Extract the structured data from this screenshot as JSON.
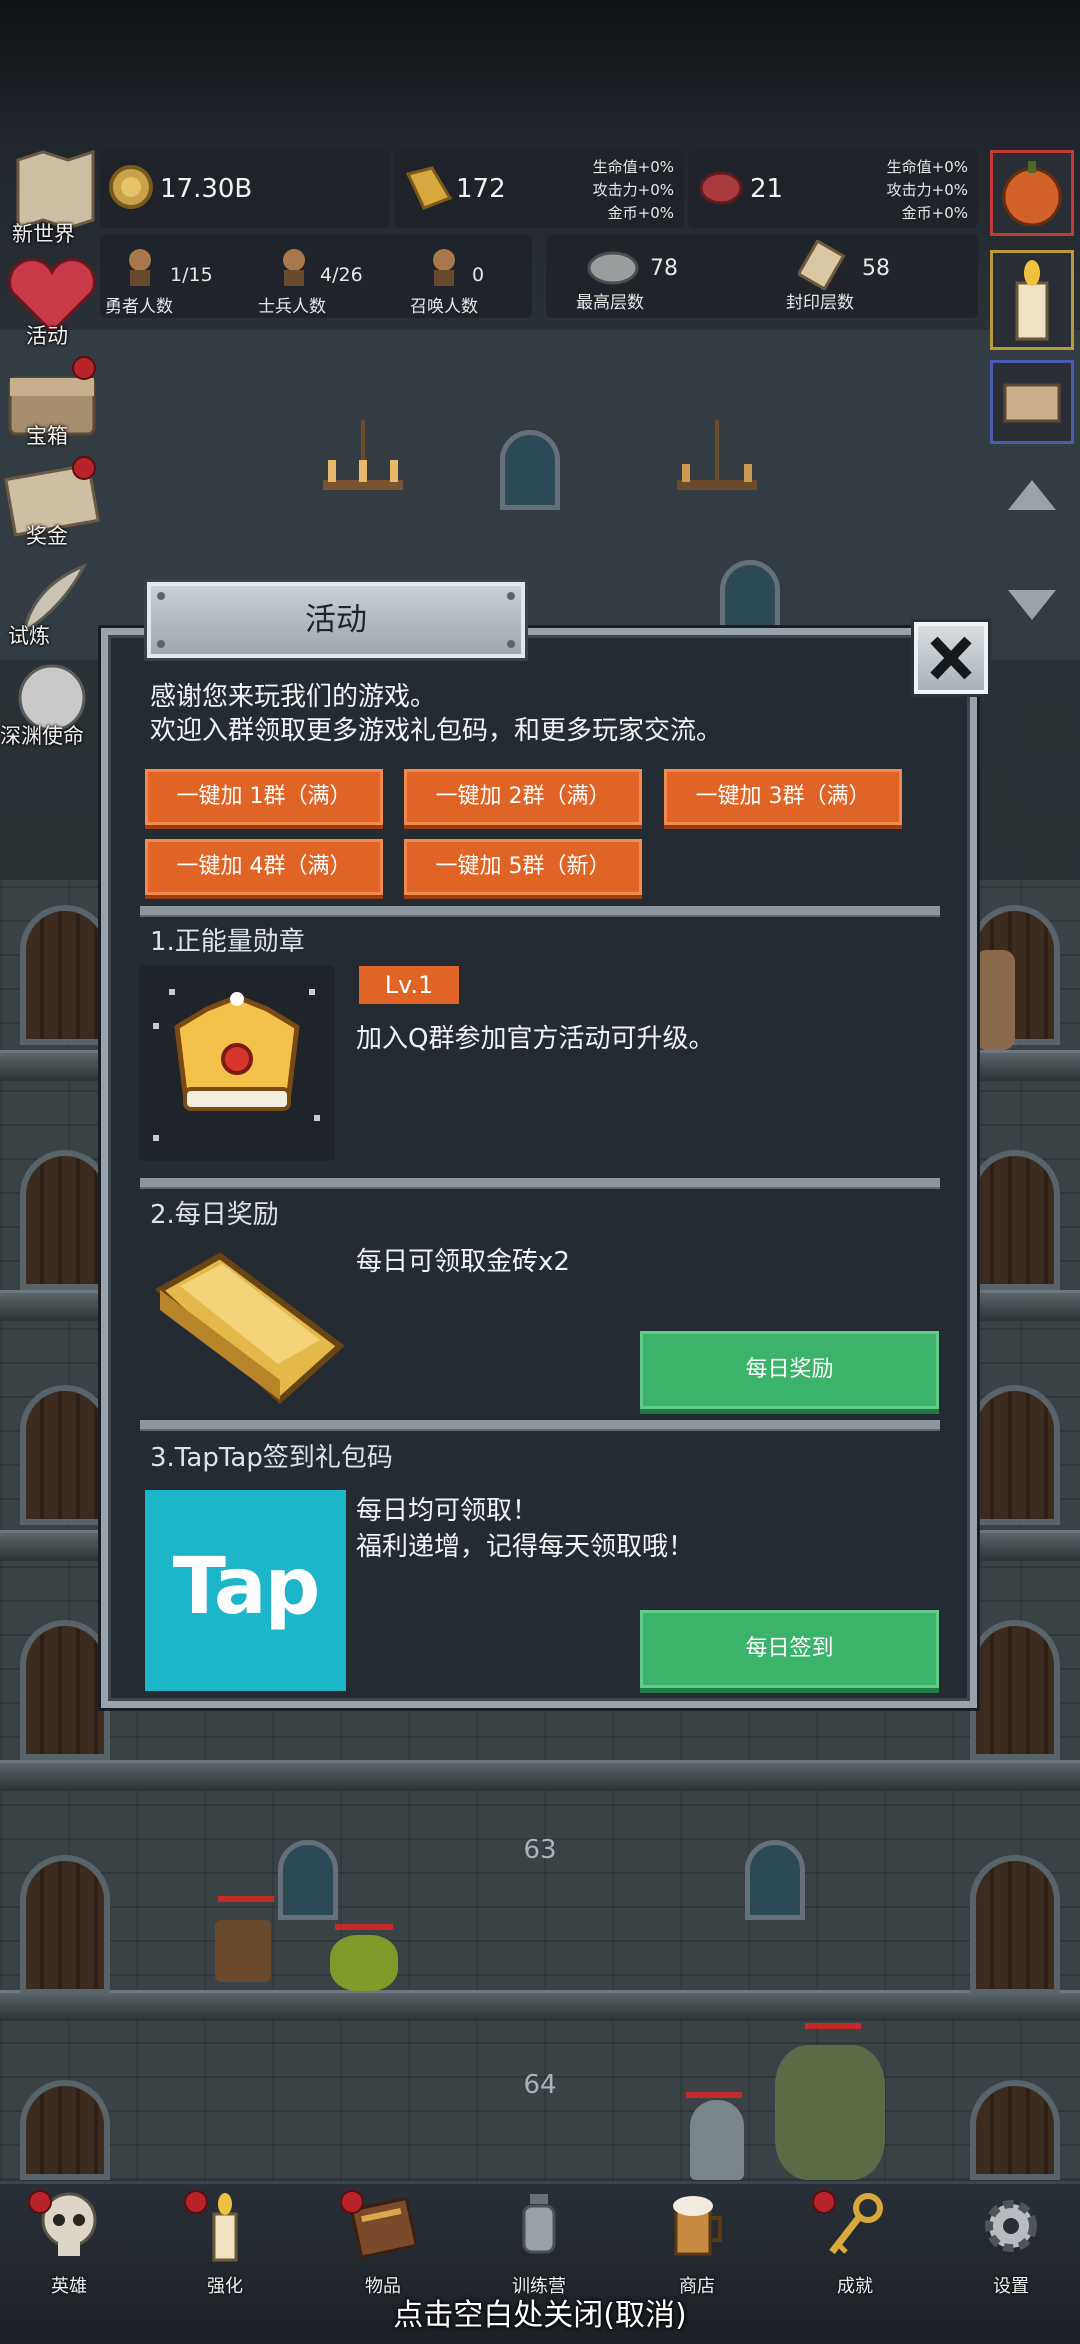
{
  "hud": {
    "gold": "17.30B",
    "gold_bar": "172",
    "meat": "21",
    "gold_bar_stats": [
      "生命值+0%",
      "攻击力+0%",
      "金币+0%"
    ],
    "meat_stats": [
      "生命值+0%",
      "攻击力+0%",
      "金币+0%"
    ],
    "heroes": {
      "value": "1/15",
      "label": "勇者人数"
    },
    "soldiers": {
      "value": "4/26",
      "label": "士兵人数"
    },
    "summons": {
      "value": "0",
      "label": "召唤人数"
    },
    "max_floor": {
      "value": "78",
      "label": "最高层数"
    },
    "sealed_floor": {
      "value": "58",
      "label": "封印层数"
    }
  },
  "left_menu": [
    "新世界",
    "活动",
    "宝箱",
    "奖金",
    "试炼",
    "深渊使命"
  ],
  "floors": {
    "upper": "63",
    "lower": "64"
  },
  "dialog": {
    "title": "活动",
    "intro_line1": "感谢您来玩我们的游戏。",
    "intro_line2": "欢迎入群领取更多游戏礼包码，和更多玩家交流。",
    "group_buttons": [
      "一键加 1群（满）",
      "一键加 2群（满）",
      "一键加 3群（满）",
      "一键加 4群（满）",
      "一键加 5群（新）"
    ],
    "section1": {
      "title": "1.正能量勋章",
      "level": "Lv.1",
      "text": "加入Q群参加官方活动可升级。"
    },
    "section2": {
      "title": "2.每日奖励",
      "text": "每日可领取金砖x2",
      "button": "每日奖励"
    },
    "section3": {
      "title": "3.TapTap签到礼包码",
      "text": "每日均可领取！\n福利递增，记得每天领取哦！",
      "button": "每日签到",
      "logo_text": "Tap"
    }
  },
  "bottom_nav": [
    "英雄",
    "强化",
    "物品",
    "训练营",
    "商店",
    "成就",
    "设置"
  ],
  "close_hint": "点击空白处关闭(取消)",
  "colors": {
    "orange": "#e06426",
    "green": "#3bb36a",
    "tap": "#1cb5c9",
    "panel": "#252b33"
  }
}
